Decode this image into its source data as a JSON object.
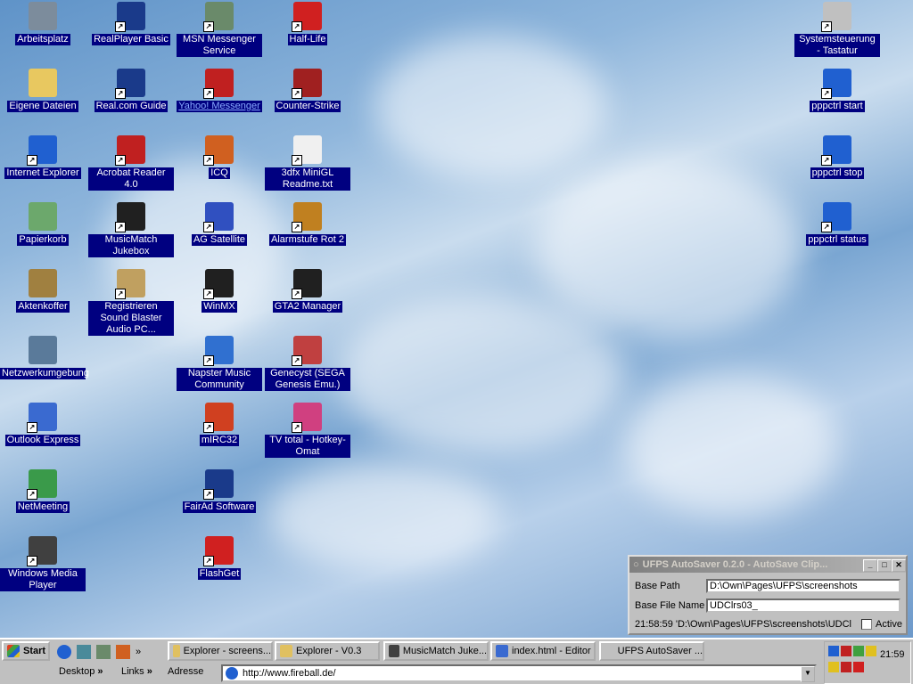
{
  "desktop_icons": [
    {
      "label": "Arbeitsplatz",
      "icon": "computer-icon",
      "color": "#7c8c9c"
    },
    {
      "label": "Eigene Dateien",
      "icon": "folder-icon",
      "color": "#e8c860"
    },
    {
      "label": "Internet Explorer",
      "icon": "ie-icon",
      "color": "#2060d0"
    },
    {
      "label": "Papierkorb",
      "icon": "recycle-bin-icon",
      "color": "#6ca86c"
    },
    {
      "label": "Aktenkoffer",
      "icon": "briefcase-icon",
      "color": "#a08040"
    },
    {
      "label": "Netzwerkumgebung",
      "icon": "network-icon",
      "color": "#5a7a9a"
    },
    {
      "label": "Outlook Express",
      "icon": "outlook-icon",
      "color": "#3a6ad0"
    },
    {
      "label": "NetMeeting",
      "icon": "netmeeting-icon",
      "color": "#3a9a4a"
    },
    {
      "label": "Windows Media Player",
      "icon": "media-player-icon",
      "color": "#404040"
    },
    {
      "label": "RealPlayer Basic",
      "icon": "realplayer-icon",
      "color": "#1a3a8a"
    },
    {
      "label": "Real.com Guide",
      "icon": "realguide-icon",
      "color": "#1a3a8a"
    },
    {
      "label": "Acrobat Reader 4.0",
      "icon": "acrobat-icon",
      "color": "#c02020"
    },
    {
      "label": "MusicMatch Jukebox",
      "icon": "musicmatch-icon",
      "color": "#202020"
    },
    {
      "label": "Registrieren Sound Blaster Audio PC...",
      "icon": "soundblaster-icon",
      "color": "#c0a060"
    },
    {
      "label": "MSN Messenger Service",
      "icon": "msn-icon",
      "color": "#6a8a6a"
    },
    {
      "label": "Yahoo! Messenger",
      "icon": "yahoo-icon",
      "color": "#c02020"
    },
    {
      "label": "ICQ",
      "icon": "icq-icon",
      "color": "#d06020"
    },
    {
      "label": "AG Satellite",
      "icon": "satellite-icon",
      "color": "#3050c0"
    },
    {
      "label": "WinMX",
      "icon": "winmx-icon",
      "color": "#202020"
    },
    {
      "label": "Napster Music Community",
      "icon": "napster-icon",
      "color": "#3070d0"
    },
    {
      "label": "mIRC32",
      "icon": "mirc-icon",
      "color": "#d04020"
    },
    {
      "label": "FairAd Software",
      "icon": "fairad-icon",
      "color": "#1a3a8a"
    },
    {
      "label": "FlashGet",
      "icon": "flashget-icon",
      "color": "#d02020"
    },
    {
      "label": "Half-Life",
      "icon": "half-life-icon",
      "color": "#d02020"
    },
    {
      "label": "Counter-Strike",
      "icon": "counter-strike-icon",
      "color": "#a02020"
    },
    {
      "label": "3dfx MiniGL Readme.txt",
      "icon": "text-file-icon",
      "color": "#f0f0f0"
    },
    {
      "label": "Alarmstufe Rot 2",
      "icon": "alarmstufe-icon",
      "color": "#c08020"
    },
    {
      "label": "GTA2 Manager",
      "icon": "gta2-icon",
      "color": "#202020"
    },
    {
      "label": "Genecyst (SEGA Genesis Emu.)",
      "icon": "genecyst-icon",
      "color": "#c04040"
    },
    {
      "label": "TV total - Hotkey-Omat",
      "icon": "tvtotal-icon",
      "color": "#d04080"
    },
    {
      "label": "Systemsteuerung - Tastatur",
      "icon": "keyboard-icon",
      "color": "#c0c0c0"
    },
    {
      "label": "pppctrl start",
      "icon": "ie-shortcut-icon",
      "color": "#2060d0"
    },
    {
      "label": "pppctrl stop",
      "icon": "ie-shortcut-icon",
      "color": "#2060d0"
    },
    {
      "label": "pppctrl status",
      "icon": "ie-shortcut-icon",
      "color": "#2060d0"
    }
  ],
  "autosaver": {
    "title": "UFPS AutoSaver 0.2.0 - AutoSave Clip...",
    "base_path_label": "Base Path",
    "base_path_value": "D:\\Own\\Pages\\UFPS\\screenshots",
    "base_file_label": "Base File Name",
    "base_file_value": "UDClrs03_",
    "status_text": "21:58:59 'D:\\Own\\Pages\\UFPS\\screenshots\\UDCl",
    "active_label": "Active"
  },
  "taskbar": {
    "start_label": "Start",
    "tasks": [
      "Explorer - screens...",
      "Explorer - V0.3",
      "MusicMatch Juke...",
      "index.html - Editor",
      "UFPS AutoSaver ..."
    ],
    "clock": "21:59",
    "desktop_label": "Desktop",
    "links_label": "Links",
    "address_label": "Adresse",
    "address_value": "http://www.fireball.de/"
  }
}
